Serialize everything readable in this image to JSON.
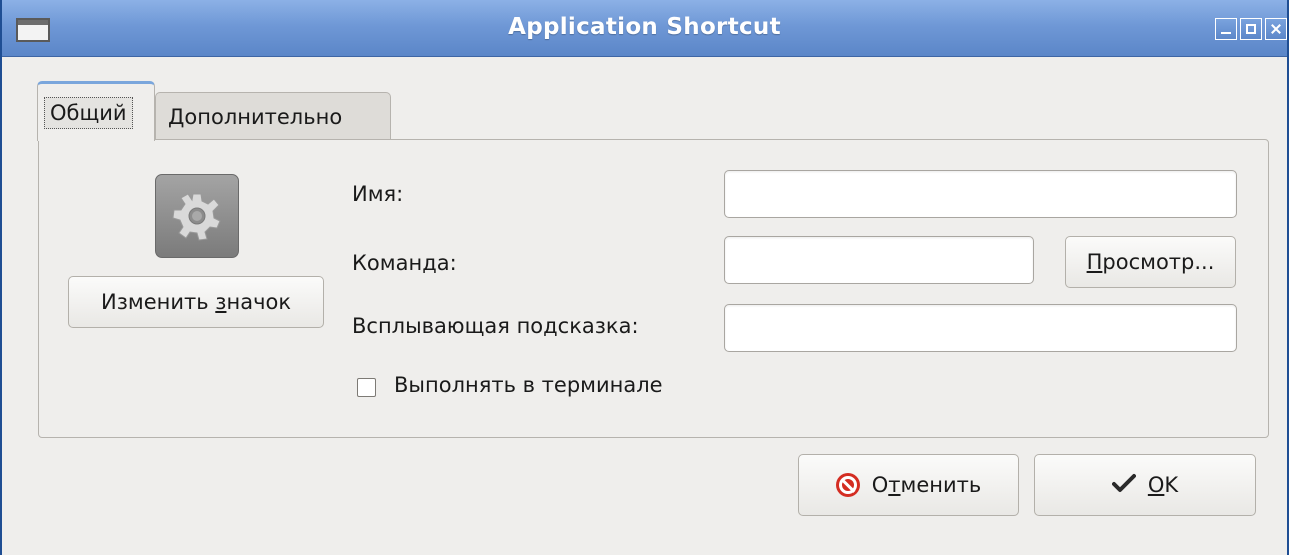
{
  "window": {
    "title": "Application Shortcut"
  },
  "tabs": [
    {
      "label": "Общий",
      "active": true
    },
    {
      "label": "Дополнительно",
      "active": false
    }
  ],
  "general": {
    "change_icon_button": {
      "before": "Изменить ",
      "mnemonic": "з",
      "after": "начок"
    },
    "icon": "gear-icon",
    "name_label": "Имя:",
    "name_value": "",
    "command_label": "Команда:",
    "command_value": "",
    "browse_button": {
      "before": "",
      "mnemonic": "П",
      "after": "росмотр..."
    },
    "tooltip_label": "Всплывающая подсказка:",
    "tooltip_value": "",
    "terminal_checkbox_label": "Выполнять в терминале",
    "terminal_checked": false
  },
  "actions": {
    "cancel": {
      "before": "О",
      "mnemonic": "т",
      "after": "менить",
      "icon": "cancel-icon"
    },
    "ok": {
      "before": "",
      "mnemonic": "O",
      "after": "K",
      "icon": "checkmark-icon"
    }
  },
  "colors": {
    "titlebar": "#6f98d6",
    "cancel_icon": "#d42d22",
    "window_bg": "#efeeec"
  }
}
